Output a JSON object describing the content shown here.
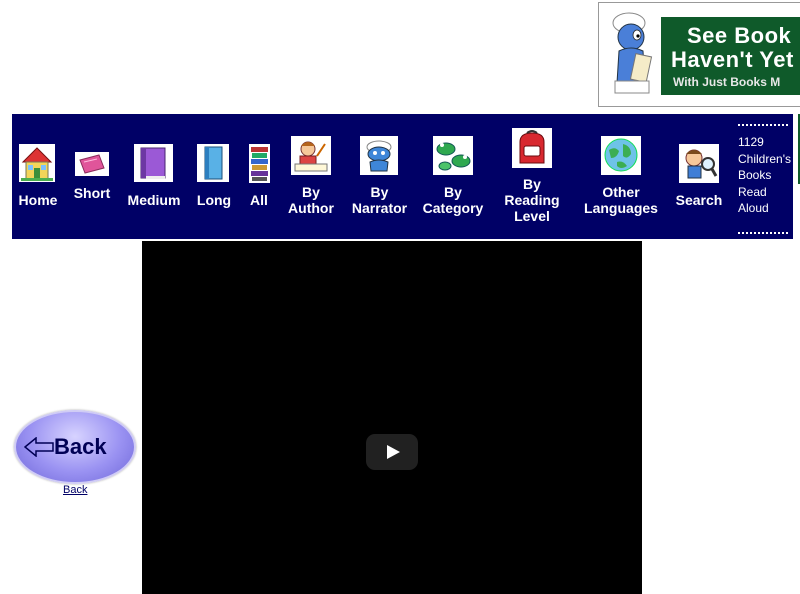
{
  "ad": {
    "line1": "See Book",
    "line2": "Haven't Yet",
    "line3": "With Just Books M",
    "colors": {
      "panel": "#0f5a2a",
      "text": "#ffffff"
    }
  },
  "nav": {
    "background": "#000066",
    "items": [
      {
        "label": "Home",
        "icon": "house-icon"
      },
      {
        "label": "Short",
        "icon": "pink-book-icon"
      },
      {
        "label": "Medium",
        "icon": "purple-book-icon"
      },
      {
        "label": "Long",
        "icon": "blue-book-icon"
      },
      {
        "label": "All",
        "icon": "book-stack-icon"
      },
      {
        "label": "By Author",
        "icon": "author-writing-icon"
      },
      {
        "label": "By Narrator",
        "icon": "narrator-icon"
      },
      {
        "label": "By Category",
        "icon": "frogs-icon"
      },
      {
        "label": "By Reading Level",
        "icon": "backpack-icon"
      },
      {
        "label": "Other Languages",
        "icon": "globe-icon"
      },
      {
        "label": "Search",
        "icon": "magnifier-kid-icon"
      }
    ],
    "count_text": "1129 Children's Books Read Aloud"
  },
  "back": {
    "button_text": "Back",
    "link_text": "Back",
    "icon": "left-arrow-icon"
  },
  "video": {
    "play_icon": "play-button-icon"
  }
}
